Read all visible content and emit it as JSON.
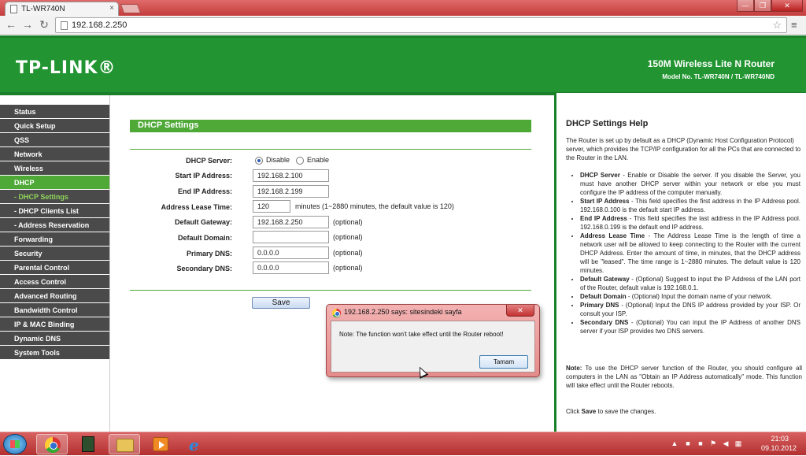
{
  "browser": {
    "tab_title": "TL-WR740N",
    "tab_close": "×",
    "url": "192.168.2.250",
    "back": "←",
    "forward": "→",
    "reload": "↻",
    "star": "☆",
    "wrench": "🔧",
    "win_min": "—",
    "win_max": "❐",
    "win_close": "✕"
  },
  "header": {
    "logo": "TP-LINK®",
    "product": "150M Wireless Lite N Router",
    "model": "Model No. TL-WR740N / TL-WR740ND"
  },
  "sidebar": {
    "items": [
      {
        "label": "Status"
      },
      {
        "label": "Quick Setup"
      },
      {
        "label": "QSS"
      },
      {
        "label": "Network"
      },
      {
        "label": "Wireless"
      },
      {
        "label": "DHCP"
      },
      {
        "label": "- DHCP Settings"
      },
      {
        "label": "- DHCP Clients List"
      },
      {
        "label": "- Address Reservation"
      },
      {
        "label": "Forwarding"
      },
      {
        "label": "Security"
      },
      {
        "label": "Parental Control"
      },
      {
        "label": "Access Control"
      },
      {
        "label": "Advanced Routing"
      },
      {
        "label": "Bandwidth Control"
      },
      {
        "label": "IP & MAC Binding"
      },
      {
        "label": "Dynamic DNS"
      },
      {
        "label": "System Tools"
      }
    ]
  },
  "form": {
    "title": "DHCP Settings",
    "dhcp_server_label": "DHCP Server:",
    "disable_label": "Disable",
    "enable_label": "Enable",
    "start_ip_label": "Start IP Address:",
    "start_ip": "192.168.2.100",
    "end_ip_label": "End IP Address:",
    "end_ip": "192.168.2.199",
    "lease_label": "Address Lease Time:",
    "lease": "120",
    "lease_hint": "minutes (1~2880 minutes, the default value is 120)",
    "gateway_label": "Default Gateway:",
    "gateway": "192.168.2.250",
    "domain_label": "Default Domain:",
    "domain": "",
    "pdns_label": "Primary DNS:",
    "pdns": "0.0.0.0",
    "sdns_label": "Secondary DNS:",
    "sdns": "0.0.0.0",
    "optional": "(optional)",
    "save": "Save"
  },
  "help": {
    "title": "DHCP Settings Help",
    "intro": "The Router is set up by default as a DHCP (Dynamic Host Configuration Protocol) server, which provides the TCP/IP configuration for all the PCs that are connected to the Router in the LAN.",
    "items": [
      {
        "term": "DHCP Server",
        "text": " - Enable or Disable the server. If you disable the Server, you must have another DHCP server within your network or else you must configure the IP address of the computer manually."
      },
      {
        "term": "Start IP Address",
        "text": " - This field specifies the first address in the IP Address pool. 192.168.0.100 is the default start IP address."
      },
      {
        "term": "End IP Address",
        "text": " - This field specifies the last address in the IP Address pool. 192.168.0.199 is the default end IP address."
      },
      {
        "term": "Address Lease Time",
        "text": " - The Address Lease Time is the length of time a network user will be allowed to keep connecting to the Router with the current DHCP Address. Enter the amount of time, in minutes, that the DHCP address will be \"leased\". The time range is 1~2880 minutes. The default value is 120 minutes."
      },
      {
        "term": "Default Gateway",
        "text": " - (Optional) Suggest to input the IP Address of the LAN port of the Router, default value is 192.168.0.1."
      },
      {
        "term": "Default Domain",
        "text": " - (Optional) Input the domain name of your network."
      },
      {
        "term": "Primary DNS",
        "text": " - (Optional) Input the DNS IP address provided by your ISP. Or consult your ISP."
      },
      {
        "term": "Secondary DNS",
        "text": " - (Optional) You can input the IP Address of another DNS server if your ISP provides two DNS servers."
      }
    ],
    "note_term": "Note:",
    "note": " To use the DHCP server function of the Router, you should configure all computers in the LAN as \"Obtain an IP Address automatically\" mode. This function will take effect until the Router reboots.",
    "click_pre": "Click ",
    "click_term": "Save",
    "click_post": " to save the changes."
  },
  "dialog": {
    "title": "192.168.2.250 says: sitesindeki sayfa",
    "close": "✕",
    "message": "Note: The function won't take effect until the Router reboot!",
    "ok": "Tamam"
  },
  "taskbar": {
    "time": "21:03",
    "date": "09.10.2012",
    "ie_glyph": "e",
    "tray_up": "▲"
  }
}
